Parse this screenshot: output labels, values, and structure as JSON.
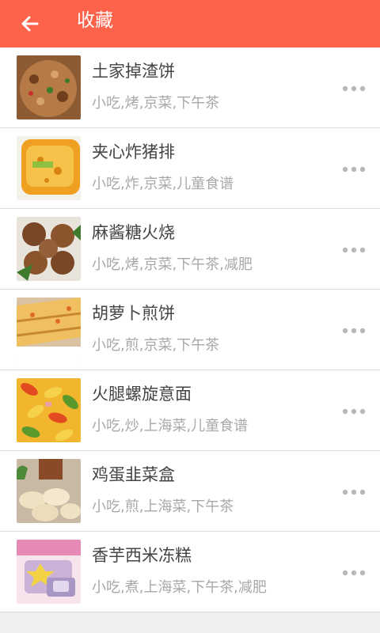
{
  "header": {
    "title": "收藏",
    "back_icon": "arrow-left-icon",
    "background_color": "#fd624b"
  },
  "favorites": [
    {
      "name": "土家掉渣饼",
      "tags": "小吃,烤,京菜,下午茶",
      "image": "tujia-pancake-photo",
      "more_icon": "more-horizontal-icon"
    },
    {
      "name": "夹心炸猪排",
      "tags": "小吃,炸,京菜,儿童食谱",
      "image": "fried-pork-cutlet-photo",
      "more_icon": "more-horizontal-icon"
    },
    {
      "name": "麻酱糖火烧",
      "tags": "小吃,烤,京菜,下午茶,减肥",
      "image": "sesame-sugar-biscuit-photo",
      "more_icon": "more-horizontal-icon"
    },
    {
      "name": "胡萝卜煎饼",
      "tags": "小吃,煎,京菜,下午茶",
      "image": "carrot-pancake-photo",
      "more_icon": "more-horizontal-icon"
    },
    {
      "name": "火腿螺旋意面",
      "tags": "小吃,炒,上海菜,儿童食谱",
      "image": "ham-fusilli-photo",
      "more_icon": "more-horizontal-icon"
    },
    {
      "name": "鸡蛋韭菜盒",
      "tags": "小吃,煎,上海菜,下午茶",
      "image": "egg-chive-pocket-photo",
      "more_icon": "more-horizontal-icon"
    },
    {
      "name": "香芋西米冻糕",
      "tags": "小吃,煮,上海菜,下午茶,减肥",
      "image": "taro-sago-jelly-photo",
      "more_icon": "more-horizontal-icon"
    }
  ]
}
